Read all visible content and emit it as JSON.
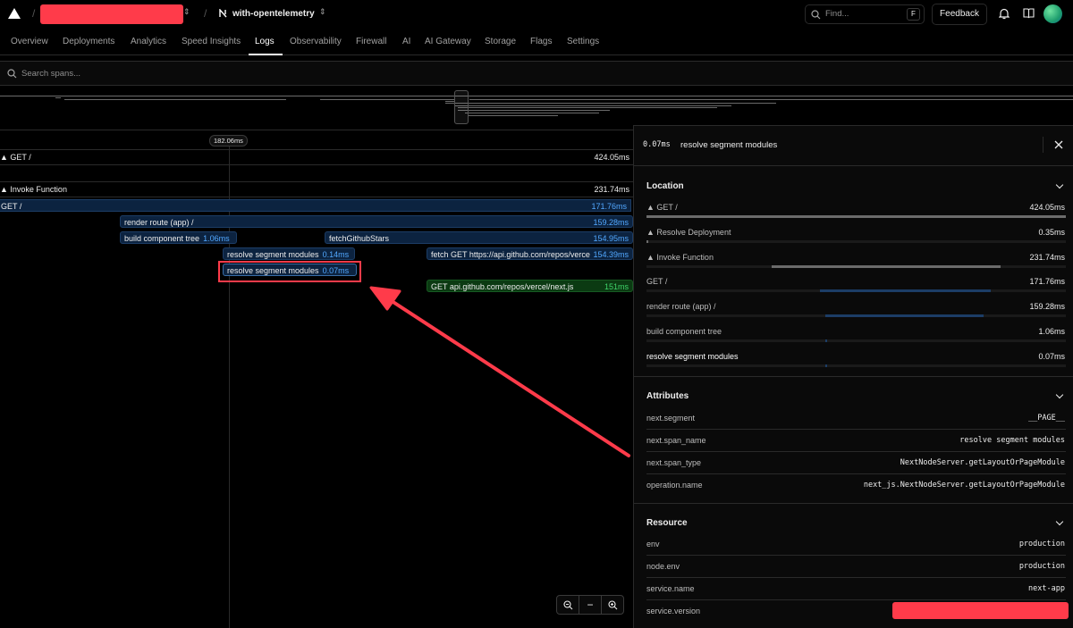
{
  "header": {
    "project_name": "with-opentelemetry",
    "find_placeholder": "Find...",
    "find_shortcut": "F",
    "feedback_label": "Feedback"
  },
  "tabs": [
    {
      "label": "Overview"
    },
    {
      "label": "Deployments"
    },
    {
      "label": "Analytics"
    },
    {
      "label": "Speed Insights"
    },
    {
      "label": "Logs",
      "active": true
    },
    {
      "label": "Observability"
    },
    {
      "label": "Firewall"
    },
    {
      "label": "AI"
    },
    {
      "label": "AI Gateway"
    },
    {
      "label": "Storage"
    },
    {
      "label": "Flags"
    },
    {
      "label": "Settings"
    }
  ],
  "search": {
    "placeholder": "Search spans..."
  },
  "timeline": {
    "cursor_label": "182.06ms",
    "rows": [
      {
        "label": "▲ GET /",
        "duration": "424.05ms"
      },
      {
        "label": "▲ Invoke Function",
        "duration": "231.74ms"
      }
    ],
    "spans": [
      {
        "label": "GET /",
        "duration": "171.76ms"
      },
      {
        "label": "render route (app) /",
        "duration": "159.28ms"
      },
      {
        "label": "build component tree",
        "duration": "1.06ms"
      },
      {
        "label": "fetchGithubStars",
        "duration": "154.95ms"
      },
      {
        "label": "resolve segment modules",
        "duration": "0.14ms"
      },
      {
        "label": "fetch GET https://api.github.com/repos/vercel/next.js",
        "duration": "154.39ms"
      },
      {
        "label": "resolve segment modules",
        "duration": "0.07ms"
      },
      {
        "label": "GET api.github.com/repos/vercel/next.js",
        "duration": "151ms"
      }
    ]
  },
  "panel": {
    "duration": "0.07ms",
    "title": "resolve segment modules",
    "location_title": "Location",
    "location": [
      {
        "label": "▲ GET /",
        "value": "424.05ms"
      },
      {
        "label": "▲ Resolve Deployment",
        "value": "0.35ms"
      },
      {
        "label": "▲ Invoke Function",
        "value": "231.74ms"
      },
      {
        "label": "GET /",
        "value": "171.76ms"
      },
      {
        "label": "render route (app) /",
        "value": "159.28ms"
      },
      {
        "label": "build component tree",
        "value": "1.06ms"
      },
      {
        "label": "resolve segment modules",
        "value": "0.07ms"
      }
    ],
    "attributes_title": "Attributes",
    "attributes": [
      {
        "key": "next.segment",
        "value": "__PAGE__"
      },
      {
        "key": "next.span_name",
        "value": "resolve segment modules"
      },
      {
        "key": "next.span_type",
        "value": "NextNodeServer.getLayoutOrPageModule"
      },
      {
        "key": "operation.name",
        "value": "next_js.NextNodeServer.getLayoutOrPageModule"
      }
    ],
    "resource_title": "Resource",
    "resource": [
      {
        "key": "env",
        "value": "production"
      },
      {
        "key": "node.env",
        "value": "production"
      },
      {
        "key": "service.name",
        "value": "next-app"
      },
      {
        "key": "service.version",
        "value": ""
      }
    ]
  },
  "colors": {
    "annotation": "#ff3b4a",
    "span_blue": "#52a8ff",
    "span_green": "#3fd46a"
  }
}
